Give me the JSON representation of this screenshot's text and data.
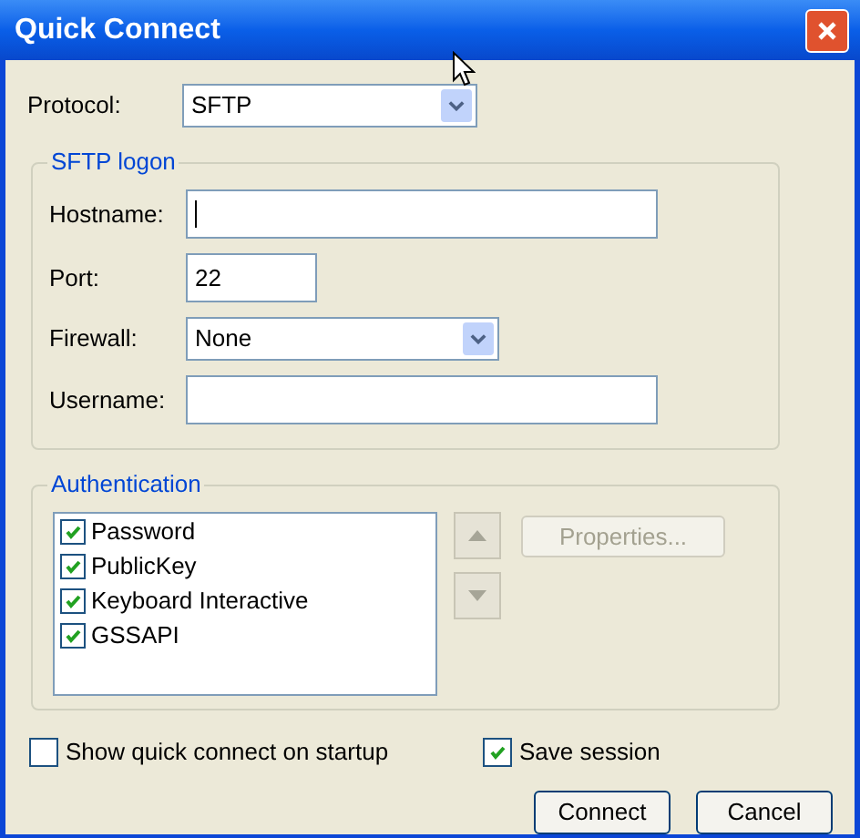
{
  "window": {
    "title": "Quick Connect"
  },
  "protocol": {
    "label": "Protocol:",
    "value": "SFTP"
  },
  "logon": {
    "title": "SFTP logon",
    "fields": [
      {
        "kind": "input",
        "label": "Hostname:",
        "focused": true
      },
      {
        "kind": "short_input",
        "label": "Port:",
        "value": "22",
        "focused": false
      },
      {
        "kind": "select",
        "label": "Firewall:",
        "value": "None"
      },
      {
        "kind": "input",
        "label": "Username:",
        "focused": false
      }
    ]
  },
  "authentication": {
    "title": "Authentication",
    "methods": [
      {
        "label": "Password",
        "checked": true
      },
      {
        "label": "PublicKey",
        "checked": true
      },
      {
        "label": "Keyboard Interactive",
        "checked": true
      },
      {
        "label": "GSSAPI",
        "checked": true
      }
    ],
    "properties_button": {
      "label": "Properties...",
      "disabled": true
    }
  },
  "options": [
    {
      "label": "Show quick connect on startup",
      "checked": false
    },
    {
      "label": "Save session",
      "checked": true
    }
  ],
  "buttons": [
    "Connect",
    "Cancel"
  ]
}
